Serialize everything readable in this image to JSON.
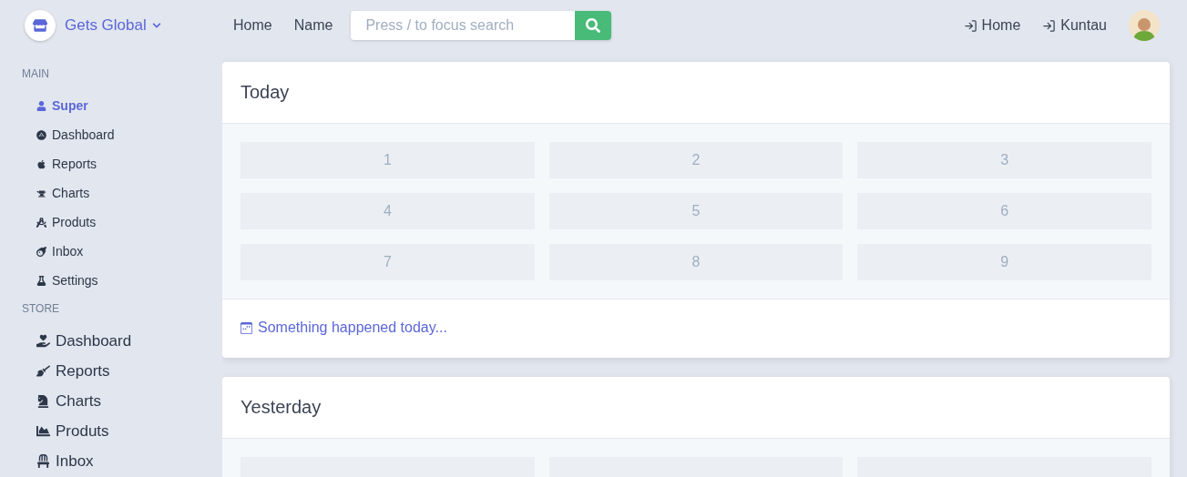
{
  "brand": {
    "name": "Gets Global"
  },
  "nav": {
    "links": [
      "Home",
      "Name"
    ],
    "search": {
      "placeholder": "Press / to focus search"
    },
    "actions": [
      "Home",
      "Kuntau"
    ]
  },
  "sidebar": {
    "sections": [
      {
        "title": "MAIN",
        "items": [
          {
            "label": "Super",
            "selected": true
          },
          {
            "label": "Dashboard",
            "selected": false
          },
          {
            "label": "Reports",
            "selected": false
          },
          {
            "label": "Charts",
            "selected": false
          },
          {
            "label": "Produts",
            "selected": false
          },
          {
            "label": "Inbox",
            "selected": false
          },
          {
            "label": "Settings",
            "selected": false
          }
        ]
      },
      {
        "title": "STORE",
        "items": [
          {
            "label": "Dashboard",
            "selected": false
          },
          {
            "label": "Reports",
            "selected": false
          },
          {
            "label": "Charts",
            "selected": false
          },
          {
            "label": "Produts",
            "selected": false
          },
          {
            "label": "Inbox",
            "selected": false
          }
        ]
      }
    ]
  },
  "cards": [
    {
      "title": "Today",
      "cells": [
        "1",
        "2",
        "3",
        "4",
        "5",
        "6",
        "7",
        "8",
        "9"
      ],
      "footer": "Something happened today..."
    },
    {
      "title": "Yesterday"
    }
  ]
}
